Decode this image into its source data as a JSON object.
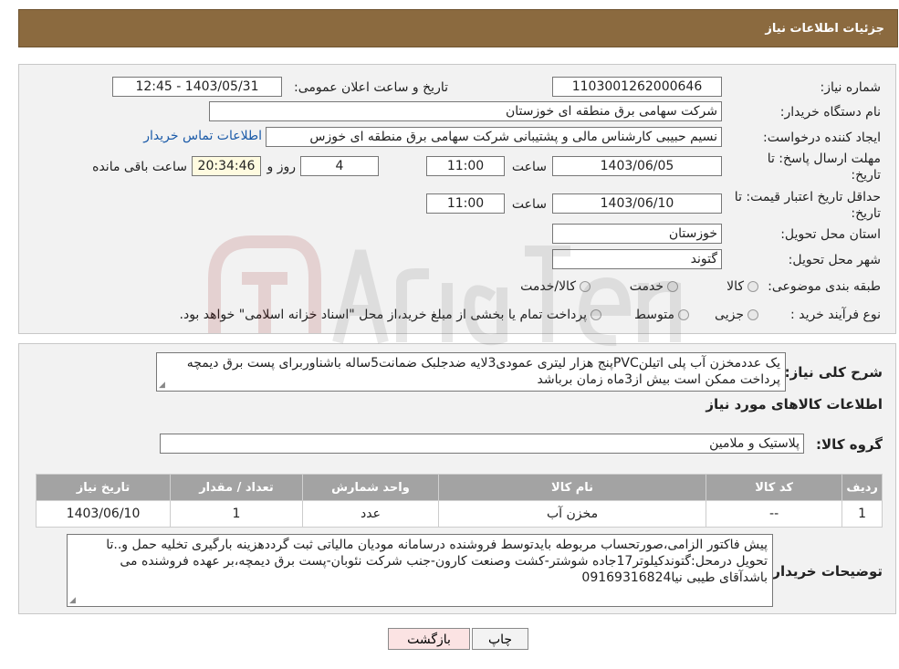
{
  "header": {
    "title": "جزئیات اطلاعات نیاز"
  },
  "form": {
    "need_number_label": "شماره نیاز:",
    "need_number": "1103001262000646",
    "announce_label": "تاریخ و ساعت اعلان عمومی:",
    "announce_value": "1403/05/31 - 12:45",
    "buyer_org_label": "نام دستگاه خریدار:",
    "buyer_org": "شرکت سهامی برق منطقه ای خوزستان",
    "requester_label": "ایجاد کننده درخواست:",
    "requester": "نسیم حبیبی کارشناس  مالی و پشتیبانی شرکت سهامی برق منطقه ای خوزس",
    "contact_link": "اطلاعات تماس خریدار",
    "deadline_label_1": "مهلت ارسال پاسخ: تا",
    "deadline_label_2": "تاریخ:",
    "deadline_date": "1403/06/05",
    "time_label": "ساعت",
    "deadline_time": "11:00",
    "days_value": "4",
    "days_label": "روز و",
    "remaining_value": "20:34:46",
    "remaining_label": "ساعت باقی مانده",
    "validity_label_1": "حداقل تاریخ اعتبار قیمت: تا",
    "validity_label_2": "تاریخ:",
    "validity_date": "1403/06/10",
    "validity_time_label": "ساعت",
    "validity_time": "11:00",
    "province_label": "استان محل تحویل:",
    "province": "خوزستان",
    "city_label": "شهر محل تحویل:",
    "city": "گتوند",
    "category_label": "طبقه بندی موضوعی:",
    "category_options": [
      "کالا",
      "خدمت",
      "کالا/خدمت"
    ],
    "purchase_type_label": "نوع فرآیند خرید :",
    "purchase_options": [
      "جزیی",
      "متوسط"
    ],
    "purchase_note": "پرداخت تمام یا بخشی از مبلغ خرید،از محل \"اسناد خزانه اسلامی\" خواهد بود."
  },
  "details": {
    "summary_label": "شرح کلی نیاز:",
    "summary_text": "یک عددمخزن آب پلی اتیلنPVCپنج هزار لیتری عمودی3لایه ضدجلبک ضمانت5ساله باشناوربرای پست برق دیمچه پرداخت ممکن است بیش از3ماه زمان برباشد",
    "goods_info_title": "اطلاعات کالاهای مورد نیاز",
    "goods_group_label": "گروه کالا:",
    "goods_group": "پلاستیک و ملامین",
    "table": {
      "headers": [
        "ردیف",
        "کد کالا",
        "نام کالا",
        "واحد شمارش",
        "تعداد / مقدار",
        "تاریخ نیاز"
      ],
      "rows": [
        [
          "1",
          "--",
          "مخزن آب",
          "عدد",
          "1",
          "1403/06/10"
        ]
      ]
    },
    "buyer_notes_label": "توضیحات خریدار:",
    "buyer_notes": "پیش فاکتور الزامی،صورتحساب مربوطه بایدتوسط فروشنده درسامانه مودیان مالیاتی ثبت گرددهزینه بارگیری تخلیه حمل و..تا تحویل درمحل:گتوندکیلوتر17جاده شوشتر-کشت وصنعت کارون-جنب شرکت نئوبان-پست برق دیمچه،بر عهده فروشنده می باشدآقای طیبی نیا09169316824"
  },
  "buttons": {
    "print": "چاپ",
    "back": "بازگشت"
  },
  "colors": {
    "header_bg": "#8b6a3f",
    "back_button_bg": "#fbe3e3",
    "print_button_bg": "#f3f3f3"
  }
}
